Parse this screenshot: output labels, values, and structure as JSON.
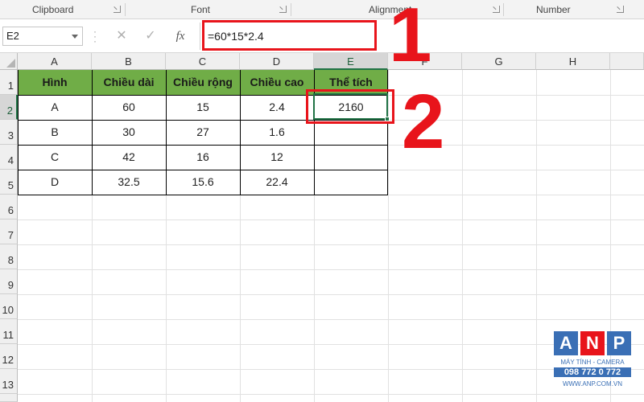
{
  "ribbon": {
    "groups": [
      {
        "label": "Clipboard"
      },
      {
        "label": "Font"
      },
      {
        "label": "Alignment"
      },
      {
        "label": "Number"
      }
    ]
  },
  "formula_bar": {
    "name_box": "E2",
    "cancel_icon": "close-icon",
    "enter_icon": "checkmark-icon",
    "fx_label": "fx",
    "formula": "=60*15*2.4"
  },
  "sheet": {
    "columns": [
      "A",
      "B",
      "C",
      "D",
      "E",
      "F",
      "G",
      "H"
    ],
    "rows": [
      "1",
      "2",
      "3",
      "4",
      "5",
      "6",
      "7",
      "8",
      "9",
      "10",
      "11",
      "12",
      "13"
    ],
    "active_cell": "E2",
    "table": {
      "header": [
        "Hình",
        "Chiều dài",
        "Chiều rộng",
        "Chiều cao",
        "Thể tích"
      ],
      "rows": [
        [
          "A",
          "60",
          "15",
          "2.4",
          "2160"
        ],
        [
          "B",
          "30",
          "27",
          "1.6",
          ""
        ],
        [
          "C",
          "42",
          "16",
          "12",
          ""
        ],
        [
          "D",
          "32.5",
          "15.6",
          "22.4",
          ""
        ]
      ],
      "header_fill": "#70ad47"
    }
  },
  "annotations": {
    "step1": "1",
    "step2": "2",
    "color": "#e8141b"
  },
  "logo": {
    "letters": [
      "A",
      "N",
      "P"
    ],
    "tagline": "MÁY TÍNH - CAMERA",
    "phone": "098 772 0 772",
    "website": "WWW.ANP.COM.VN",
    "colors": [
      "#3a6fb5",
      "#e8141b",
      "#3a6fb5"
    ]
  }
}
